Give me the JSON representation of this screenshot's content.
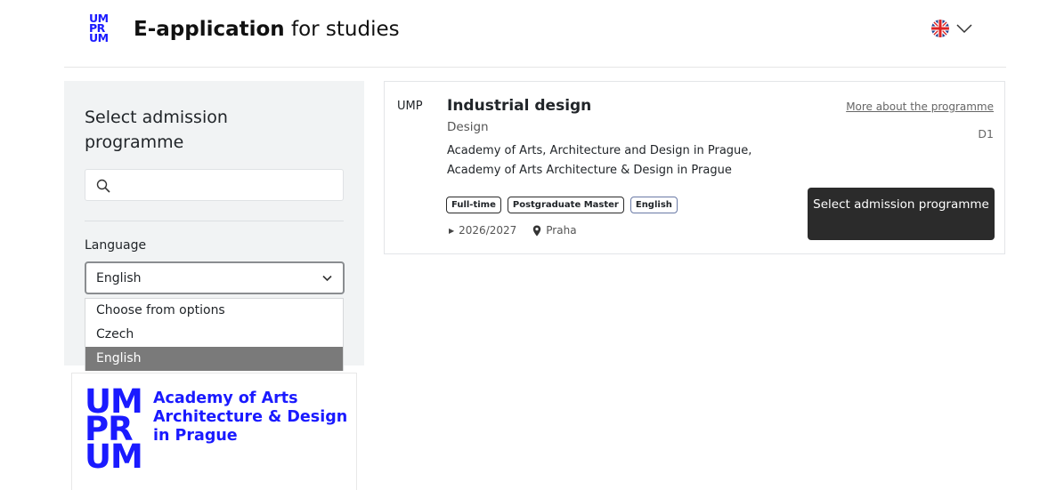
{
  "header": {
    "logo_lines": [
      "UM",
      "PR",
      "UM"
    ],
    "title_bold": "E-application",
    "title_rest": " for studies",
    "language_switcher": {
      "icon": "uk-flag-icon",
      "chevron": "chevron-down-icon"
    }
  },
  "sidebar": {
    "title": "Select admission programme",
    "search": {
      "placeholder": "",
      "value": ""
    },
    "language_label": "Language",
    "language_select": {
      "value": "English",
      "options": [
        "Choose from options",
        "Czech",
        "English"
      ],
      "selected_index": 2
    }
  },
  "brand": {
    "mark_lines": [
      "UM",
      "PR",
      "UM"
    ],
    "text_lines": [
      "Academy of Arts",
      "Architecture & Design",
      "in Prague"
    ]
  },
  "programme": {
    "faculty_code": "UMP",
    "title": "Industrial design",
    "field": "Design",
    "faculty_lines": [
      "Academy of Arts, Architecture and Design in Prague,",
      "Academy of Arts Architecture & Design in Prague"
    ],
    "more_link": "More about the programme",
    "code": "D1",
    "tags": [
      "Full-time",
      "Postgraduate Master",
      "English"
    ],
    "year": "2026/2027",
    "location": "Praha",
    "select_button": "Select admission programme"
  },
  "colors": {
    "brand_blue": "#1a1aff",
    "button_dark": "#2b2b2b",
    "sidebar_bg": "#f1f3f4",
    "selected_option_bg": "#7a7a7a"
  }
}
